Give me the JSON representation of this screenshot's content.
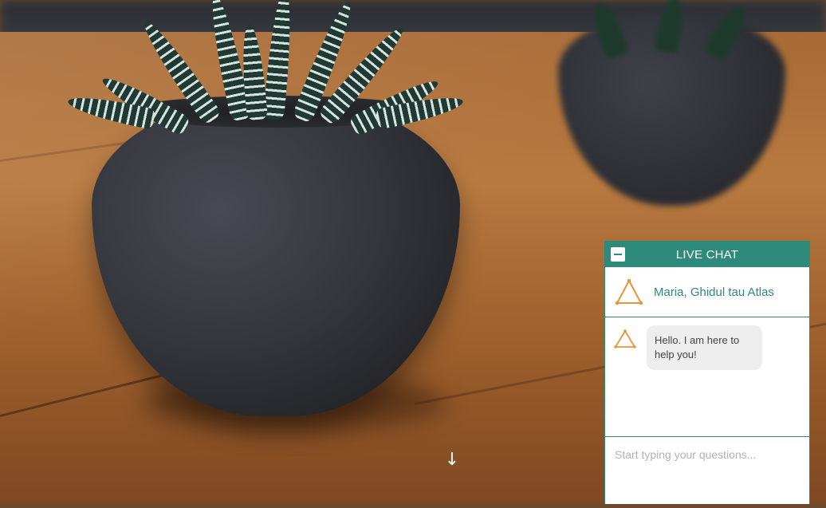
{
  "chat": {
    "title": "LIVE CHAT",
    "agent_name": "Maria, Ghidul tau Atlas",
    "messages": [
      {
        "sender": "agent",
        "text": "Hello. I am here to help you!"
      }
    ],
    "input_placeholder": "Start typing your questions...",
    "icons": {
      "minimize": "minus-icon",
      "agent_avatar": "triangle-logo-icon",
      "message_avatar": "triangle-logo-icon"
    },
    "colors": {
      "accent": "#2e8b7b",
      "logo": "#e8953a",
      "bubble": "#eeeeee"
    }
  },
  "page": {
    "scroll_icon": "arrow-down-icon"
  }
}
